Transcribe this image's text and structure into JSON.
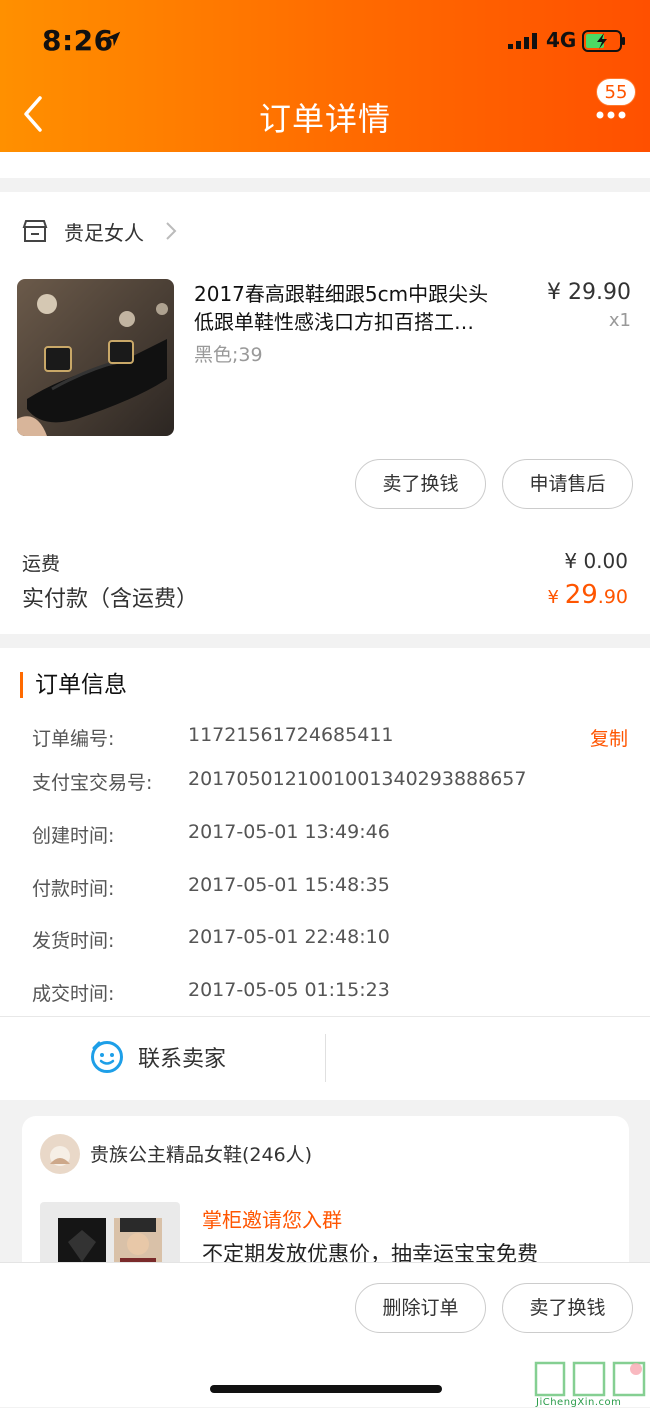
{
  "status_bar": {
    "time": "8:26",
    "network": "4G"
  },
  "nav": {
    "title": "订单详情",
    "badge_count": "55"
  },
  "shop": {
    "name": "贵足女人"
  },
  "product": {
    "title_line1": "2017春高跟鞋细跟5cm中跟尖头",
    "title_line2": "低跟单鞋性感浅口方扣百搭工…",
    "sku": "黑色;39",
    "price": "¥ 29.90",
    "qty": "x1"
  },
  "actions": {
    "sell": "卖了换钱",
    "after_sale": "申请售后"
  },
  "summary": {
    "fee_label": "运费",
    "fee_value": "¥ 0.00",
    "paid_label": "实付款（含运费）",
    "paid_currency": "¥ ",
    "paid_int": "29",
    "paid_dec": ".90"
  },
  "order_info": {
    "title": "订单信息",
    "copy_label": "复制",
    "rows": [
      {
        "label": "订单编号:",
        "value": "11721561724685411"
      },
      {
        "label": "支付宝交易号:",
        "value": "2017050121001001340293888657"
      },
      {
        "label": "创建时间:",
        "value": "2017-05-01 13:49:46"
      },
      {
        "label": "付款时间:",
        "value": "2017-05-01 15:48:35"
      },
      {
        "label": "发货时间:",
        "value": "2017-05-01 22:48:10"
      },
      {
        "label": "成交时间:",
        "value": "2017-05-05 01:15:23"
      }
    ],
    "contact_label": "联系卖家"
  },
  "group": {
    "name": "贵族公主精品女鞋(246人)",
    "invite": "掌柜邀请您入群",
    "desc": "不定期发放优惠价，抽幸运宝宝免费"
  },
  "bottom": {
    "delete": "删除订单",
    "sell": "卖了换钱"
  },
  "watermark": {
    "text": "JiChengXin.com"
  },
  "colors": {
    "accent": "#ff5500",
    "header_start": "#ff9000",
    "header_end": "#ff5000"
  }
}
